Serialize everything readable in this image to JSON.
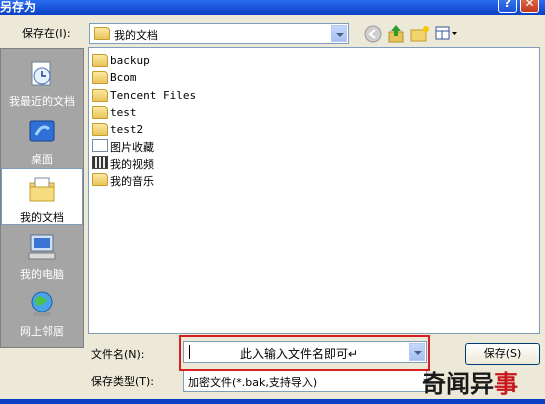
{
  "window": {
    "title": "另存为"
  },
  "toolbar": {
    "save_in_label": "保存在(I):",
    "location": "我的文档"
  },
  "places": [
    {
      "label": "我最近的文档"
    },
    {
      "label": "桌面"
    },
    {
      "label": "我的文档",
      "selected": true
    },
    {
      "label": "我的电脑"
    },
    {
      "label": "网上邻居"
    }
  ],
  "files": [
    {
      "name": "backup",
      "icon": "folder-icon"
    },
    {
      "name": "Bcom",
      "icon": "folder-icon"
    },
    {
      "name": "Tencent Files",
      "icon": "folder-icon"
    },
    {
      "name": "test",
      "icon": "folder-icon"
    },
    {
      "name": "test2",
      "icon": "folder-icon"
    },
    {
      "name": "图片收藏",
      "icon": "pictures-folder-icon"
    },
    {
      "name": "我的视频",
      "icon": "video-folder-icon"
    },
    {
      "name": "我的音乐",
      "icon": "music-folder-icon"
    }
  ],
  "form": {
    "filename_label": "文件名(N):",
    "filename_value": "此入输入文件名即可↵",
    "filetype_label": "保存类型(T):",
    "filetype_value": "加密文件(*.bak,支持导入)",
    "save_button": "保存(S)"
  },
  "watermark": {
    "text_a": "奇闻异",
    "text_b": "事"
  }
}
